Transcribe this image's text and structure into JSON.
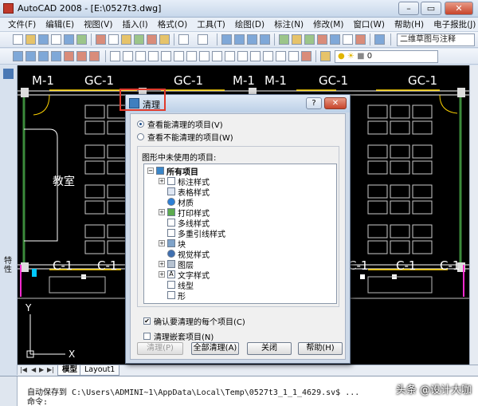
{
  "window": {
    "title": "AutoCAD 2008 - [E:\\0527t3.dwg]"
  },
  "menu": {
    "items": [
      "文件(F)",
      "编辑(E)",
      "视图(V)",
      "插入(I)",
      "格式(O)",
      "工具(T)",
      "绘图(D)",
      "标注(N)",
      "修改(M)",
      "窗口(W)",
      "帮助(H)",
      "电子报批(J)"
    ]
  },
  "toolbar": {
    "workspace": "二维草图与注释",
    "layer_value": "0"
  },
  "drawing": {
    "top_labels": [
      "M-1",
      "GC-1",
      "GC-1",
      "M-1",
      "M-1",
      "GC-1",
      "GC-1"
    ],
    "bottom_labels": [
      "C-1",
      "C-1",
      "C-1",
      "C-1",
      "C-1"
    ],
    "room_label": "教室",
    "axis_y": "Y",
    "axis_x": "X"
  },
  "left_panel": {
    "label": "特性"
  },
  "layout_tabs": {
    "tabs": [
      "模型",
      "Layout1"
    ]
  },
  "dialog": {
    "title": "清理",
    "help": "?",
    "close": "✕",
    "radio_view_purgeable": "查看能清理的项目(V)",
    "radio_view_nonpurgeable": "查看不能清理的项目(W)",
    "group_label": "图形中未使用的项目:",
    "tree": {
      "root": "所有项目",
      "items": [
        "标注样式",
        "表格样式",
        "材质",
        "打印样式",
        "多线样式",
        "多重引线样式",
        "块",
        "视觉样式",
        "图层",
        "文字样式",
        "线型",
        "形"
      ]
    },
    "check_confirm": "确认要清理的每个项目(C)",
    "check_confirm_checked": true,
    "check_nested": "清理嵌套项目(N)",
    "check_nested_checked": false,
    "buttons": {
      "purge": "清理(P)",
      "purge_all": "全部清理(A)",
      "close": "关闭",
      "help": "帮助(H)"
    }
  },
  "command": {
    "line1": "自动保存到 C:\\Users\\ADMINI~1\\AppData\\Local\\Temp\\0527t3_1_1_4629.sv$ ...",
    "line2": "命令:"
  },
  "watermark": "头条 @设计大咖"
}
